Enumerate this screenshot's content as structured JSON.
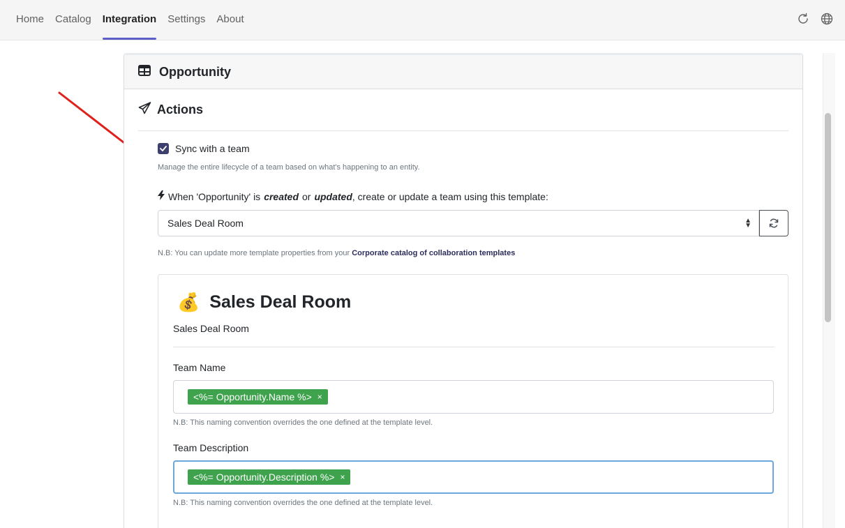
{
  "nav": {
    "items": [
      "Home",
      "Catalog",
      "Integration",
      "Settings",
      "About"
    ],
    "active": "Integration"
  },
  "icons": {
    "refresh": "refresh-icon",
    "globe": "globe-icon",
    "table": "table-icon",
    "send": "paper-plane-icon",
    "bolt": "lightning-bolt-icon",
    "money_bag": "money-bag-emoji"
  },
  "card": {
    "title": "Opportunity",
    "actions_title": "Actions",
    "sync_label": "Sync with a team",
    "sync_checked": true,
    "sync_help": "Manage the entire lifecycle of a team based on what's happening to an entity.",
    "when_prefix": "When 'Opportunity' is",
    "when_created": "created",
    "when_or": "or",
    "when_updated": "updated",
    "when_suffix": ", create or update a team using this template:",
    "template_select": "Sales Deal Room",
    "nb_prefix": "N.B: You can update more template properties from your",
    "nb_link": "Corporate catalog of collaboration templates"
  },
  "template": {
    "emoji": "💰",
    "title": "Sales Deal Room",
    "subtitle": "Sales Deal Room",
    "team_name_label": "Team Name",
    "team_name_tag": "<%= Opportunity.Name %>",
    "team_name_nb": "N.B: This naming convention overrides the one defined at the template level.",
    "team_desc_label": "Team Description",
    "team_desc_tag": "<%= Opportunity.Description %>",
    "team_desc_nb": "N.B: This naming convention overrides the one defined at the template level.",
    "tag_remove": "×"
  },
  "colors": {
    "accent": "#5b5fc7",
    "checkbox": "#3d3f6e",
    "tag": "#3fa34d",
    "arrow": "#e0201b"
  }
}
